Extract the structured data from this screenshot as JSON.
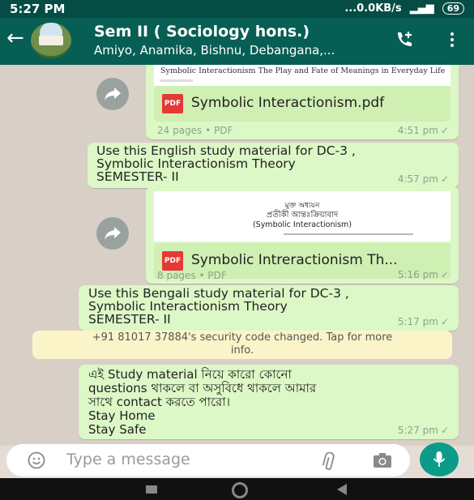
{
  "status_bar": {
    "time": "5:27 PM",
    "net_speed": "...0.0KB/s",
    "battery": "69"
  },
  "header": {
    "title": "Sem II ( Sociology hons.)",
    "subtitle": "Amiyo, Anamika, Bishnu, Debangana,..."
  },
  "messages": [
    {
      "type": "document",
      "preview_title": "Symbolic Interactionism The Play and Fate of Meanings in Everyday Life",
      "file_name": "Symbolic Interactionism.pdf",
      "meta": "24 pages • PDF",
      "time": "4:51 pm"
    },
    {
      "type": "text",
      "lines": [
        "Use this English study material for DC-3 ,",
        "Symbolic Interactionism Theory",
        "SEMESTER- II"
      ],
      "time": "4:57 pm"
    },
    {
      "type": "document",
      "preview_lines": [
        "মুক্ত অধ্যয়ন",
        "প্রতীকী আন্তঃক্রিয়াবাদ",
        "(Symbolic Interactionism)"
      ],
      "file_name": "Symbolic Intreractionism Th...",
      "meta": "8 pages • PDF",
      "time": "5:16 pm"
    },
    {
      "type": "text",
      "lines": [
        "Use this Bengali study material for DC-3 ,",
        "Symbolic Interactionism Theory",
        "SEMESTER- II"
      ],
      "time": "5:17 pm"
    },
    {
      "type": "system",
      "lines": [
        "+91 81017 37884's security code changed. Tap for more",
        "info."
      ]
    },
    {
      "type": "text",
      "lines": [
        "এই Study material নিয়ে কারো কোনো",
        "questions থাকলে বা অসুবিধে থাকলে আমার",
        "সাথে contact করতে পারো।",
        "Stay Home",
        "Stay Safe"
      ],
      "time": "5:27 pm"
    }
  ],
  "input": {
    "placeholder": "Type a message"
  },
  "colors": {
    "header": "#075e54",
    "status_bar": "#054d44",
    "outgoing_bubble": "#dcf8c6",
    "system_notice": "#fcf4c9",
    "mic_button": "#0a9c88"
  },
  "icons": [
    "back-arrow-icon",
    "add-call-icon",
    "more-options-icon",
    "share-icon",
    "pdf-icon",
    "double-check-icon",
    "emoji-icon",
    "attach-icon",
    "camera-icon",
    "mic-icon"
  ]
}
